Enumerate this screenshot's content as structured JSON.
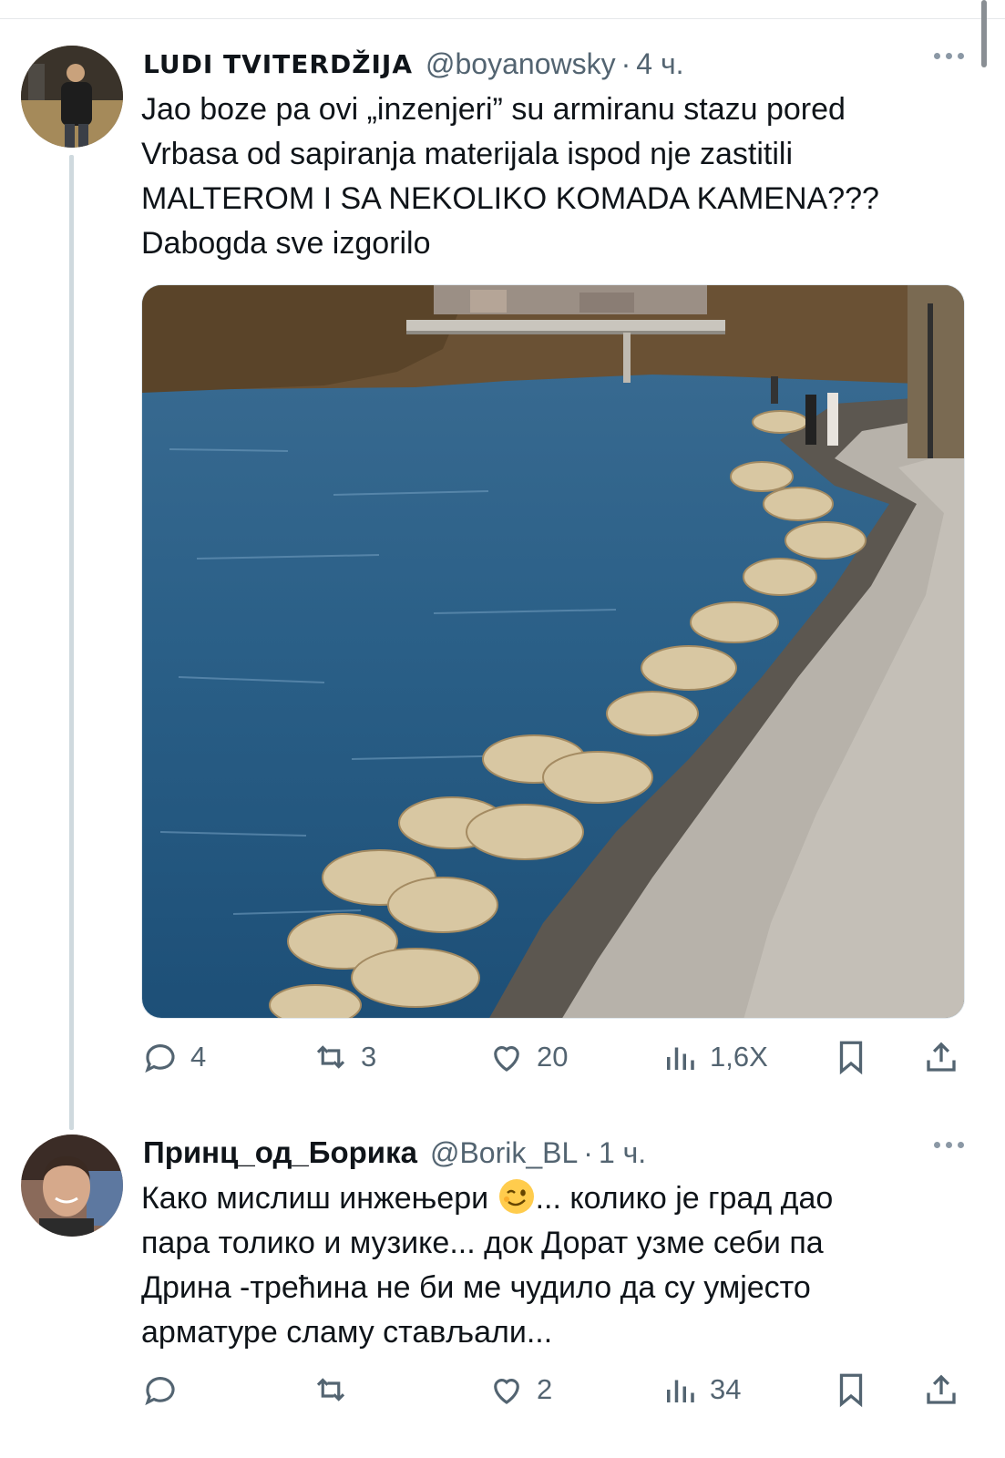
{
  "tweets": [
    {
      "display_name": "LUDI TVITERDŽIJA",
      "handle": "@boyanowsky",
      "separator": "·",
      "time": "4 ч.",
      "text": "Jao boze pa ovi „inzenjeri” su armiranu stazu pored\nVrbasa od sapiranja materijala ispod nje zastitili\nMALTEROM I SA NEKOLIKO KOMADA KAMENA???\nDabogda sve izgorilo",
      "actions": {
        "replies": "4",
        "reposts": "3",
        "likes": "20",
        "views": "1,6Х"
      },
      "icons": [
        "reply-icon",
        "repost-icon",
        "like-icon",
        "views-icon",
        "bookmark-icon",
        "share-icon",
        "more-icon"
      ]
    },
    {
      "display_name": "Принц_од_Борика",
      "handle": "@Borik_BL",
      "separator": "·",
      "time": "1 ч.",
      "text_before_emoji": "Како мислиш инжењери ",
      "text_after_emoji": "... колико је град дао\nпара толико и музике... док Дорат узме себи па\nДрина -трећина не би ме чудило да су умјесто\nарматуре сламу стављали...",
      "emoji_icon": "winking-face-emoji",
      "actions": {
        "replies": "",
        "reposts": "",
        "likes": "2",
        "views": "34"
      }
    }
  ],
  "colors": {
    "text": "#0f1419",
    "muted": "#536471",
    "thread_line": "#cfd9de"
  }
}
